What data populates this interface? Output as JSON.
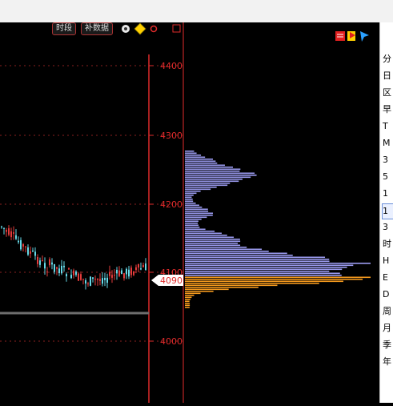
{
  "toolbar": {
    "time_segment_label": "时段",
    "fill_data_label": "补数据"
  },
  "price_axis": {
    "ticks": [
      "4400",
      "4300",
      "4200",
      "4100",
      "4000"
    ],
    "current_price": "4090"
  },
  "right_panel": {
    "items": [
      "分",
      "日",
      "区",
      "早",
      "T",
      "M",
      "3",
      "5",
      "1",
      "1",
      "3",
      "时",
      "H",
      "E",
      "D",
      "周",
      "月",
      "季",
      "年"
    ],
    "selected_index": 9
  },
  "colors": {
    "axis_red": "#e02b2b",
    "profile_upper": "#9c9cf2",
    "profile_lower": "#f59a1e",
    "candle_up": "#e33b3b",
    "candle_down": "#66d9e8"
  }
}
